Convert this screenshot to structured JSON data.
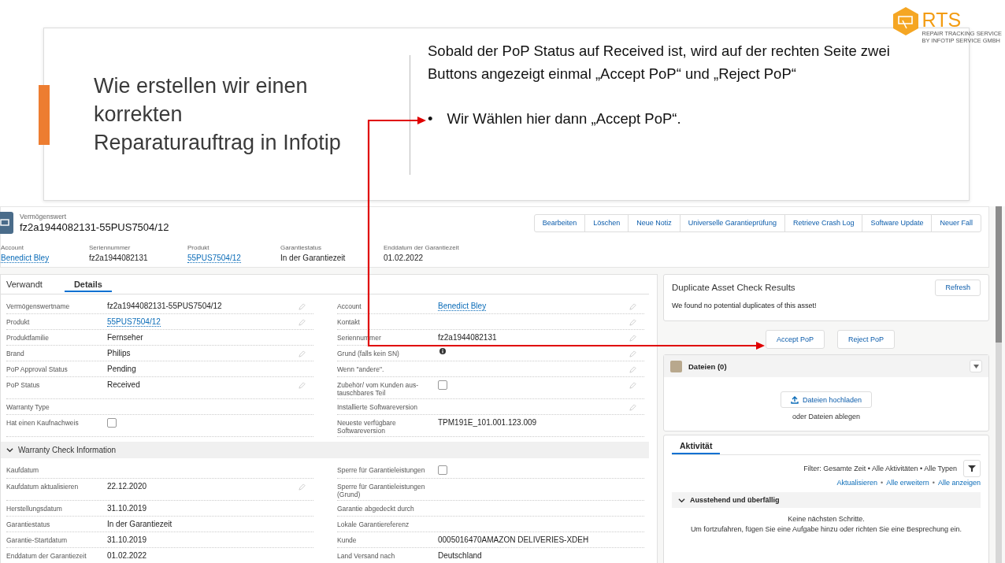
{
  "slide": {
    "title_lines": [
      "Wie erstellen wir einen",
      "korrekten",
      "Reparaturauftrag in Infotip"
    ],
    "intro": "Sobald der PoP Status auf Received ist, wird auf der rechten Seite zwei Buttons angezeigt einmal „Accept PoP“ und „Reject PoP“",
    "bullet_marker": "•",
    "bullet": "Wir Wählen hier dann „Accept PoP“."
  },
  "logo": {
    "name": "RTS",
    "line_1": "REPAIR TRACKING SERVICE",
    "line_2": "BY INFOTIP SERVICE GMBH"
  },
  "record": {
    "object_label": "Vermögenswert",
    "name": "fz2a1944082131-55PUS7504/12",
    "actions": [
      "Bearbeiten",
      "Löschen",
      "Neue Notiz",
      "Universelle Garantieprüfung",
      "Retrieve Crash Log",
      "Software Update",
      "Neuer Fall"
    ],
    "highlights": [
      {
        "label": "Account",
        "value": "Benedict Bley",
        "kind": "link"
      },
      {
        "label": "Seriennummer",
        "value": "fz2a1944082131",
        "kind": "text"
      },
      {
        "label": "Produkt",
        "value": "55PUS7504/12",
        "kind": "link"
      },
      {
        "label": "Garantiestatus",
        "value": "In der Garantiezeit",
        "kind": "text"
      },
      {
        "label": "Enddatum der Garantiezeit",
        "value": "01.02.2022",
        "kind": "text"
      }
    ]
  },
  "tabs": [
    {
      "label": "Verwandt",
      "selected": false
    },
    {
      "label": "Details",
      "selected": true
    }
  ],
  "details": {
    "rows_left": [
      {
        "label": "Vermögenswertname",
        "value": "fz2a1944082131-55PUS7504/12",
        "kind": "text",
        "editable": true
      },
      {
        "label": "Produkt",
        "value": "55PUS7504/12",
        "kind": "link",
        "editable": true
      },
      {
        "label": "Produktfamilie",
        "value": "Fernseher",
        "kind": "text",
        "editable": false
      },
      {
        "label": "Brand",
        "value": "Philips",
        "kind": "text",
        "editable": true
      },
      {
        "label": "PoP Approval Status",
        "value": "Pending",
        "kind": "text",
        "editable": false
      },
      {
        "label": "PoP Status",
        "value": "Received",
        "kind": "text",
        "editable": true
      },
      {
        "label": "Warranty Type",
        "kind": "text",
        "editable": false
      },
      {
        "label": "Hat einen Kaufnachweis",
        "kind": "checkbox",
        "checked": false,
        "editable": false
      }
    ],
    "rows_right": [
      {
        "label": "Account",
        "value": "Benedict Bley",
        "kind": "link",
        "editable": true
      },
      {
        "label": "Kontakt",
        "kind": "text",
        "editable": true
      },
      {
        "label": "Seriennummer",
        "value": "fz2a1944082131",
        "kind": "text",
        "editable": true
      },
      {
        "label": "Grund (falls kein SN)",
        "kind": "text",
        "editable": true,
        "info": true
      },
      {
        "label": "Wenn \"andere\".",
        "kind": "text",
        "editable": true
      },
      {
        "label": "Zubehör/ vom Kunden aus-tauschbares Teil",
        "kind": "checkbox",
        "checked": false,
        "editable": true
      },
      {
        "label": "Installierte Softwareversion",
        "kind": "text",
        "editable": true
      },
      {
        "label": "Neueste verfügbare Softwareversion",
        "value": "TPM191E_101.001.123.009",
        "kind": "text",
        "editable": false
      }
    ]
  },
  "warranty_section": {
    "title": "Warranty Check Information",
    "expanded": true,
    "rows_left": [
      {
        "label": "Kaufdatum",
        "kind": "text",
        "editable": false
      },
      {
        "label": "Kaufdatum aktualisieren",
        "value": "22.12.2020",
        "kind": "text",
        "editable": true
      },
      {
        "label": "Herstellungsdatum",
        "value": "31.10.2019",
        "kind": "text",
        "editable": false
      },
      {
        "label": "Garantiestatus",
        "value": "In der Garantiezeit",
        "kind": "text",
        "editable": false
      },
      {
        "label": "Garantie-Startdatum",
        "value": "31.10.2019",
        "kind": "text",
        "editable": false
      },
      {
        "label": "Enddatum der Garantiezeit",
        "value": "01.02.2022",
        "kind": "text",
        "editable": false
      }
    ],
    "rows_right": [
      {
        "label": "Sperre für Garantieleistungen",
        "kind": "checkbox",
        "checked": false,
        "editable": false
      },
      {
        "label": "Sperre für Garantieleistungen (Grund)",
        "kind": "text",
        "editable": false
      },
      {
        "label": "Garantie abgedeckt durch",
        "kind": "text",
        "editable": false
      },
      {
        "label": "Lokale Garantiereferenz",
        "kind": "text",
        "editable": false
      },
      {
        "label": "Kunde",
        "value": "0005016470AMAZON DELIVERIES-XDEH",
        "kind": "text",
        "editable": false
      },
      {
        "label": "Land Versand nach",
        "value": "Deutschland",
        "kind": "text",
        "editable": false
      }
    ]
  },
  "duplicate_check": {
    "title": "Duplicate Asset Check Results",
    "button": "Refresh",
    "message": "We found no potential duplicates of this asset!"
  },
  "pop_actions": [
    "Accept PoP",
    "Reject PoP"
  ],
  "files": {
    "title": "Dateien (0)",
    "upload_button": "Dateien hochladen",
    "drop_hint": "oder Dateien ablegen"
  },
  "activity": {
    "tab": {
      "label": "Aktivität",
      "selected": true
    },
    "filter": "Filter: Gesamte Zeit • Alle Aktivitäten • Alle Typen",
    "links": [
      "Aktualisieren",
      "Alle erweitern",
      "Alle anzeigen"
    ],
    "link_separator": "•",
    "section": {
      "title": "Ausstehend und überfällig",
      "expanded": true,
      "empty_lines": [
        "Keine nächsten Schritte.",
        "Um fortzufahren, fügen Sie eine Aufgabe hinzu oder richten Sie eine Besprechung ein."
      ]
    }
  }
}
